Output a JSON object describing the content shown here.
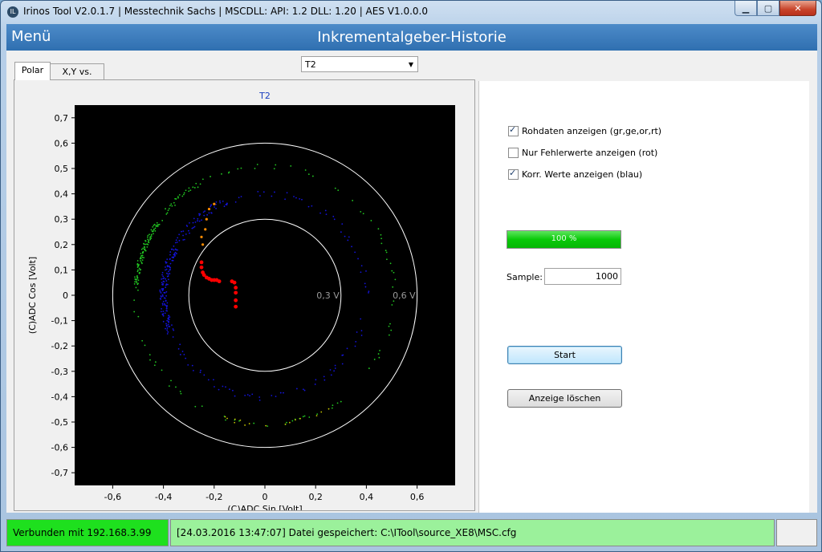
{
  "window": {
    "title": "Irinos Tool V2.0.1.7 | Messtechnik Sachs | MSCDLL: API: 1.2 DLL: 1.20 | AES V1.0.0.0",
    "app_icon": "irinos-logo-icon"
  },
  "header": {
    "menu_label": "Menü",
    "page_title": "Inkrementalgeber-Historie"
  },
  "selector": {
    "value": "T2"
  },
  "tabs": [
    {
      "label": "Polar",
      "active": true
    },
    {
      "label": "X,Y vs. Time",
      "active": false
    }
  ],
  "chart_data": {
    "type": "scatter",
    "title": "T2",
    "xlabel": "(C)ADC Sin [Volt]",
    "ylabel": "(C)ADC Cos [Volt]",
    "xlim": [
      -0.75,
      0.75
    ],
    "ylim": [
      -0.75,
      0.75
    ],
    "x_ticks": [
      "-0,6",
      "-0,4",
      "-0,2",
      "0",
      "0,2",
      "0,4",
      "0,6"
    ],
    "x_tick_values": [
      -0.6,
      -0.4,
      -0.2,
      0,
      0.2,
      0.4,
      0.6
    ],
    "y_ticks": [
      "0,7",
      "0,6",
      "0,5",
      "0,4",
      "0,3",
      "0,2",
      "0,1",
      "0",
      "-0,1",
      "-0,2",
      "-0,3",
      "-0,4",
      "-0,5",
      "-0,6",
      "-0,7"
    ],
    "y_tick_values": [
      0.7,
      0.6,
      0.5,
      0.4,
      0.3,
      0.2,
      0.1,
      0,
      -0.1,
      -0.2,
      -0.3,
      -0.4,
      -0.5,
      -0.6,
      -0.7
    ],
    "reference_circles": [
      {
        "radius": 0.3,
        "label": "0,3 V"
      },
      {
        "radius": 0.6,
        "label": "0,6 V"
      }
    ],
    "background": "#000000",
    "colors": {
      "green": "#22c822",
      "yellow": "#c8c800",
      "orange": "#ff8c00",
      "red": "#ff0000",
      "blue": "#1414dc",
      "circle": "#ffffff"
    },
    "series": [
      {
        "color": "green",
        "radius_volt": 0.51,
        "points_note": "ring, dense near 150-170°"
      },
      {
        "color": "yellow",
        "radius_volt": 0.51,
        "points_note": "ring segment near 250-290°"
      },
      {
        "color": "blue",
        "radius_volt": 0.4,
        "points_note": "ring, dense near 140-200°"
      },
      {
        "color": "red",
        "points": [
          [
            -0.25,
            0.13
          ],
          [
            -0.25,
            0.11
          ],
          [
            -0.245,
            0.09
          ],
          [
            -0.24,
            0.08
          ],
          [
            -0.23,
            0.07
          ],
          [
            -0.22,
            0.065
          ],
          [
            -0.21,
            0.06
          ],
          [
            -0.2,
            0.06
          ],
          [
            -0.19,
            0.06
          ],
          [
            -0.18,
            0.055
          ],
          [
            -0.13,
            0.055
          ],
          [
            -0.12,
            0.05
          ],
          [
            -0.115,
            0.03
          ],
          [
            -0.115,
            0.01
          ],
          [
            -0.115,
            -0.02
          ],
          [
            -0.115,
            -0.045
          ]
        ]
      },
      {
        "color": "orange",
        "points": [
          [
            -0.25,
            0.23
          ],
          [
            -0.245,
            0.2
          ],
          [
            -0.235,
            0.26
          ],
          [
            -0.23,
            0.3
          ],
          [
            -0.22,
            0.34
          ],
          [
            -0.2,
            0.36
          ]
        ]
      }
    ]
  },
  "options": {
    "raw_data": {
      "label": "Rohdaten anzeigen (gr,ge,or,rt)",
      "checked": true
    },
    "errors_only": {
      "label": "Nur Fehlerwerte anzeigen (rot)",
      "checked": false
    },
    "corrected": {
      "label": "Korr. Werte anzeigen (blau)",
      "checked": true
    }
  },
  "progress": {
    "value": 1.0,
    "text": "100 %"
  },
  "sample": {
    "label": "Sample:",
    "value": "1000"
  },
  "buttons": {
    "start": "Start",
    "clear": "Anzeige löschen"
  },
  "status": {
    "connection": "Verbunden mit 192.168.3.99",
    "message": "[24.03.2016 13:47:07] Datei gespeichert: C:\\ITool\\source_XE8\\MSC.cfg",
    "extra": ""
  }
}
